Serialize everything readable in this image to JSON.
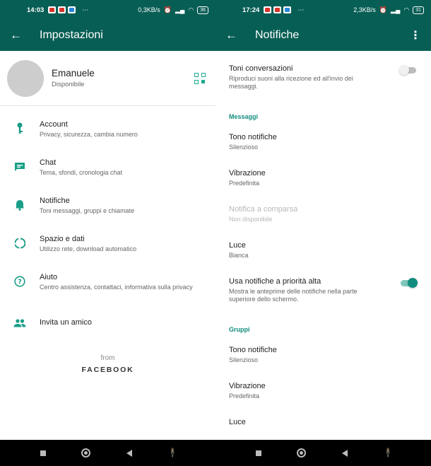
{
  "left": {
    "status": {
      "time": "14:03",
      "net_speed": "0,3KB/s",
      "battery": "36"
    },
    "appbar": {
      "title": "Impostazioni"
    },
    "profile": {
      "name": "Emanuele",
      "status": "Disponibile"
    },
    "settings": [
      {
        "title": "Account",
        "subtitle": "Privacy, sicurezza, cambia numero",
        "icon": "key-icon"
      },
      {
        "title": "Chat",
        "subtitle": "Tema, sfondi, cronologia chat",
        "icon": "chat-icon"
      },
      {
        "title": "Notifiche",
        "subtitle": "Toni messaggi, gruppi e chiamate",
        "icon": "bell-icon"
      },
      {
        "title": "Spazio e dati",
        "subtitle": "Utilizzo rete, download automatico",
        "icon": "data-usage-icon"
      },
      {
        "title": "Aiuto",
        "subtitle": "Centro assistenza, contattaci, informativa sulla privacy",
        "icon": "help-icon"
      },
      {
        "title": "Invita un amico",
        "icon": "people-icon"
      }
    ],
    "footer": {
      "from": "from",
      "brand": "FACEBOOK"
    }
  },
  "right": {
    "status": {
      "time": "17:24",
      "net_speed": "2,3KB/s",
      "battery": "31"
    },
    "appbar": {
      "title": "Notifiche"
    },
    "conversation_tones": {
      "title": "Toni conversazioni",
      "subtitle": "Riproduci suoni alla ricezione ed all'invio dei messaggi.",
      "enabled": false
    },
    "messages_section": "Messaggi",
    "messages": {
      "tone": {
        "title": "Tono notifiche",
        "value": "Silenzioso"
      },
      "vibration": {
        "title": "Vibrazione",
        "value": "Predefinita"
      },
      "popup": {
        "title": "Notifica a comparsa",
        "value": "Non disponibile"
      },
      "light": {
        "title": "Luce",
        "value": "Bianca"
      },
      "high_priority": {
        "title": "Usa notifiche a priorità alta",
        "subtitle": "Mostra le anteprime delle notifiche nella parte superiore dello schermo.",
        "enabled": true
      }
    },
    "groups_section": "Gruppi",
    "groups": {
      "tone": {
        "title": "Tono notifiche",
        "value": "Silenzioso"
      },
      "vibration": {
        "title": "Vibrazione",
        "value": "Predefinita"
      },
      "partial_label": "Luce"
    }
  },
  "colors": {
    "primary": "#075e54",
    "accent": "#128c7e",
    "icon": "#1a9e87"
  }
}
